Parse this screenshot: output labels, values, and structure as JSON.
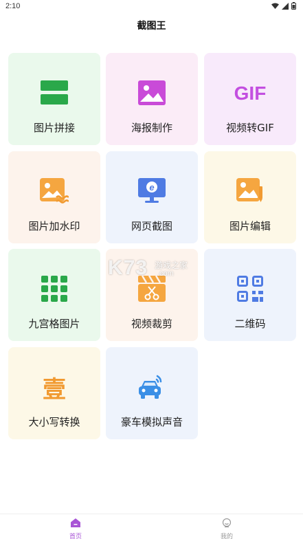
{
  "status_bar": {
    "time": "2:10"
  },
  "header": {
    "title": "截图王"
  },
  "tiles": [
    {
      "label": "图片拼接",
      "icon": "stack-icon",
      "bg": "#eaf9ec",
      "color": "#2aa84a"
    },
    {
      "label": "海报制作",
      "icon": "image-icon",
      "bg": "#fbecf7",
      "color": "#c94bd8"
    },
    {
      "label": "视频转GIF",
      "icon": "gif-icon",
      "bg": "#f8eafb",
      "color": "#c34fe0"
    },
    {
      "label": "图片加水印",
      "icon": "image-watermark-icon",
      "bg": "#fdf3ec",
      "color": "#f19a31"
    },
    {
      "label": "网页截图",
      "icon": "browser-monitor-icon",
      "bg": "#eef3fc",
      "color": "#4f7be3"
    },
    {
      "label": "图片编辑",
      "icon": "image-edit-icon",
      "bg": "#fdf8e7",
      "color": "#f19a31"
    },
    {
      "label": "九宫格图片",
      "icon": "nine-grid-icon",
      "bg": "#eaf9ec",
      "color": "#2aa84a"
    },
    {
      "label": "视频裁剪",
      "icon": "video-cut-icon",
      "bg": "#fdf3ec",
      "color": "#f19a31"
    },
    {
      "label": "二维码",
      "icon": "qr-code-icon",
      "bg": "#eef3fc",
      "color": "#4f7be3"
    },
    {
      "label": "大小写转换",
      "icon": "chinese-numeral-icon",
      "bg": "#fdf8e7",
      "color": "#f19a31",
      "glyph": "壹"
    },
    {
      "label": "豪车模拟声音",
      "icon": "car-sound-icon",
      "bg": "#eef3fc",
      "color": "#3b8fe6"
    }
  ],
  "watermark": {
    "text": "K73",
    "sub": "游戏之家",
    "domain": ".com"
  },
  "bottom_nav": {
    "home_label": "首页",
    "mine_label": "我的",
    "active_color": "#a855d6",
    "inactive_color": "#999999"
  }
}
